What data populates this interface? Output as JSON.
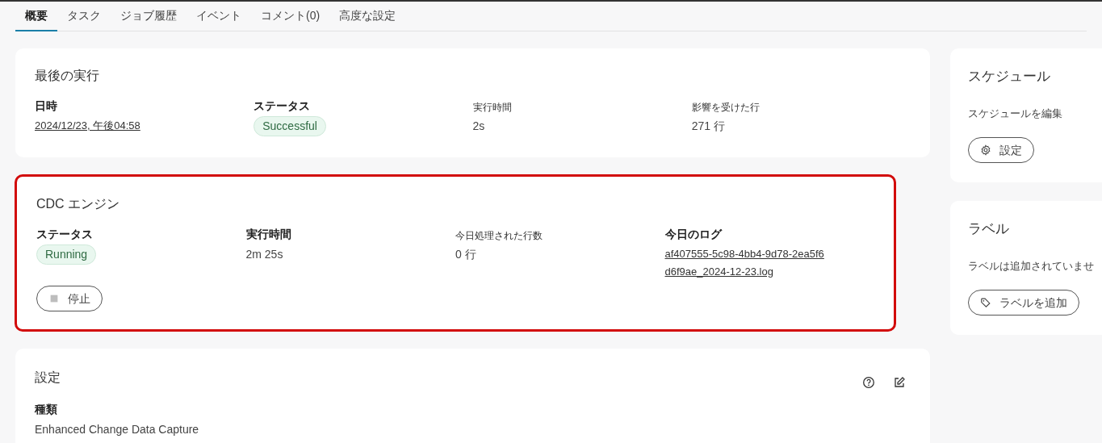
{
  "tabs": [
    {
      "label": "概要",
      "selected": true
    },
    {
      "label": "タスク",
      "selected": false
    },
    {
      "label": "ジョブ履歴",
      "selected": false
    },
    {
      "label": "イベント",
      "selected": false
    },
    {
      "label": "コメント(0)",
      "selected": false
    },
    {
      "label": "高度な設定",
      "selected": false
    }
  ],
  "main_cards": [
    {
      "title": "最後の実行",
      "highlighted": false,
      "fields": [
        {
          "label": "日時",
          "label_bold": true,
          "kind": "link",
          "value": "2024/12/23, 午後04:58"
        },
        {
          "label": "ステータス",
          "label_bold": true,
          "kind": "badge",
          "value": "Successful"
        },
        {
          "label": "実行時間",
          "label_bold": false,
          "kind": "text",
          "value": "2s"
        },
        {
          "label": "影響を受けた行",
          "label_bold": false,
          "kind": "text",
          "value": "271 行"
        }
      ]
    },
    {
      "title": "CDC エンジン",
      "highlighted": true,
      "fields": [
        {
          "label": "ステータス",
          "label_bold": true,
          "kind": "badge",
          "value": "Running"
        },
        {
          "label": "実行時間",
          "label_bold": true,
          "kind": "text",
          "value": "2m 25s"
        },
        {
          "label": "今日処理された行数",
          "label_bold": false,
          "kind": "text",
          "value": "0 行"
        },
        {
          "label": "今日のログ",
          "label_bold": true,
          "kind": "link",
          "value": "af407555-5c98-4bb4-9d78-2ea5f6d6f9ae_2024-12-23.log"
        }
      ],
      "button": {
        "label": "停止"
      }
    },
    {
      "title": "設定",
      "highlighted": false,
      "fields": [
        {
          "label": "種類",
          "label_bold": true,
          "kind": "text",
          "value": "Enhanced Change Data Capture"
        }
      ]
    }
  ],
  "side_cards": [
    {
      "title": "スケジュール",
      "text": "スケジュールを編集",
      "button": {
        "label": "設定"
      }
    },
    {
      "title": "ラベル",
      "text": "ラベルは追加されていませ",
      "button": {
        "label": "ラベルを追加"
      }
    }
  ]
}
